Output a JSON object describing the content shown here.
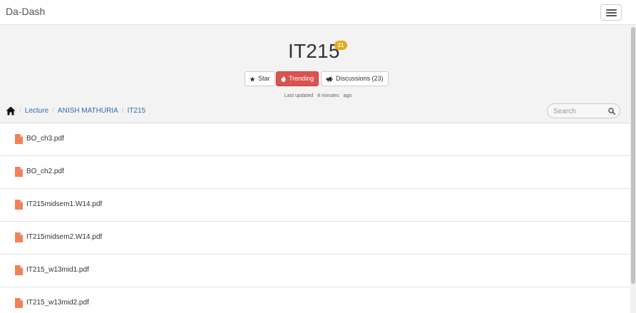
{
  "navbar": {
    "brand": "Da-Dash",
    "menu_icon": "hamburger-menu-icon"
  },
  "course": {
    "title": "IT215",
    "badge_count": "21"
  },
  "actions": {
    "star_label": "Star",
    "star_icon": "star-icon",
    "trending_label": "Trending",
    "trending_icon": "fire-icon",
    "discussions_label": "Discussions (23)",
    "discussions_icon": "bullhorn-icon"
  },
  "last_updated": {
    "prefix": "Last updated",
    "value": "8 minutes",
    "suffix": "ago"
  },
  "breadcrumb": {
    "home_icon": "home-icon",
    "items": [
      "Lecture",
      "ANISH MATHURIA",
      "IT215"
    ]
  },
  "search": {
    "placeholder": "Search",
    "icon": "search-icon"
  },
  "files": [
    {
      "name": "BO_ch3.pdf"
    },
    {
      "name": "BO_ch2.pdf"
    },
    {
      "name": "IT215midsem1.W14.pdf"
    },
    {
      "name": "IT215midsem2.W14.pdf"
    },
    {
      "name": "IT215_w13mid1.pdf"
    },
    {
      "name": "IT215_w13mid2.pdf"
    }
  ],
  "colors": {
    "accent_link": "#2a6db3",
    "trending_red": "#d9534f",
    "badge_yellow": "#e8a811",
    "file_icon": "#f0825a"
  }
}
